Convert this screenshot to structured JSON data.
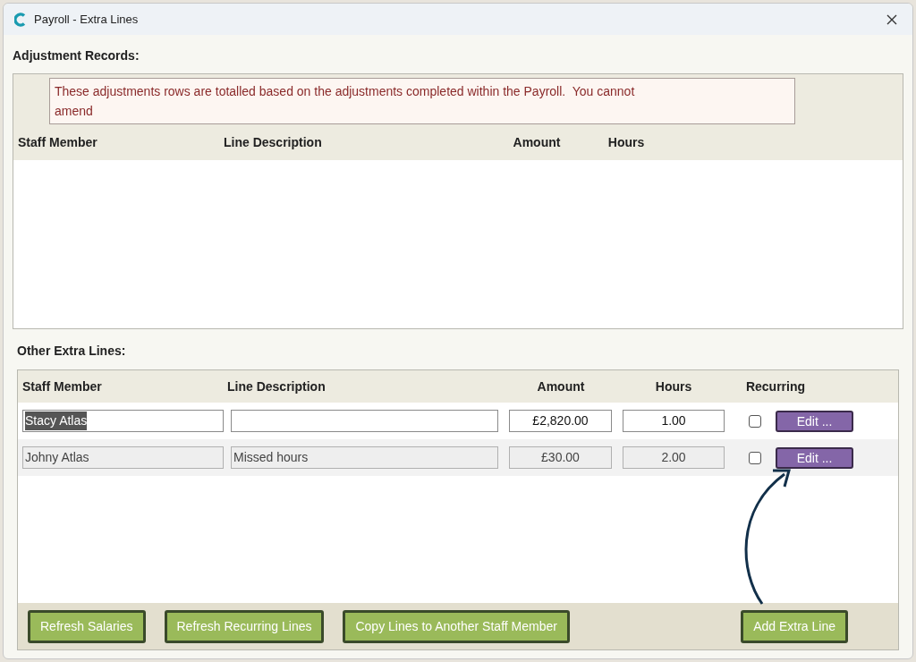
{
  "window": {
    "title": "Payroll - Extra Lines"
  },
  "adjustment_records": {
    "heading": "Adjustment Records:",
    "notice": "These adjustments rows are totalled based on the adjustments completed within the Payroll.  You cannot amend",
    "columns": [
      "Staff Member",
      "Line Description",
      "Amount",
      "Hours"
    ]
  },
  "other_extra_lines": {
    "heading": "Other Extra Lines:",
    "columns": [
      "Staff Member",
      "Line Description",
      "Amount",
      "Hours",
      "Recurring"
    ],
    "rows": [
      {
        "staff_member": "Stacy Atlas",
        "staff_text_highlighted": true,
        "amount": "£2,820.00",
        "hours": "1.00",
        "recurring": false,
        "editable": true,
        "edit_button": "Edit ..."
      },
      {
        "staff_member": "Johny Atlas",
        "staff_text_highlighted": false,
        "line_description": "Missed hours",
        "amount": "£30.00",
        "hours": "2.00",
        "recurring": false,
        "editable": false,
        "edit_button": "Edit ..."
      }
    ]
  },
  "buttons": [
    "Refresh Salaries",
    "Refresh Recurring Lines",
    "Copy Lines to Another Staff Member"
  ],
  "add_extra_line_button": "Add Extra Line"
}
